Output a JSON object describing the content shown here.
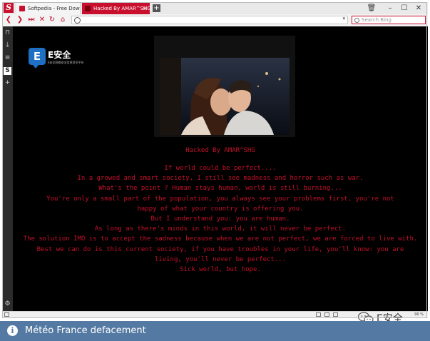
{
  "browser": {
    "tabs": [
      {
        "title": "Softpedia - Free Downloads",
        "active": false
      },
      {
        "title": "Hacked By AMAR^SHG",
        "active": true
      }
    ],
    "search_placeholder": "Search Bing",
    "zoom_level": "90 %",
    "accent_color": "#c8102e"
  },
  "page": {
    "logo_text": "E安全",
    "logo_subtext": "E安全网络安全信息资讯平台",
    "headline": "Hacked By AMAR^SHG",
    "message_lines": [
      "If world could be perfect....",
      "In a growed and smart society, I still see madness and horror such as war.",
      "What's the point ? Human stays human, world is still burning...",
      "You're only a small part of the population, you always see your problems first, you're not happy of what your country is offering you.",
      "But I understand you: you are human.",
      "As long as there's minds in this world, it will never be perfect.",
      "The solution IMO is to accept the sadness because when we are not perfect, we are forced to live with.",
      "Best we can do is this current society, if you have troubles in your life, you'll know: you are living, you'll never be perfect...",
      "Sick world, but hope."
    ],
    "text_color": "#c4102a"
  },
  "watermark": {
    "text": "E安全"
  },
  "caption": {
    "text": "Météo France defacement",
    "background": "#547aa3"
  }
}
